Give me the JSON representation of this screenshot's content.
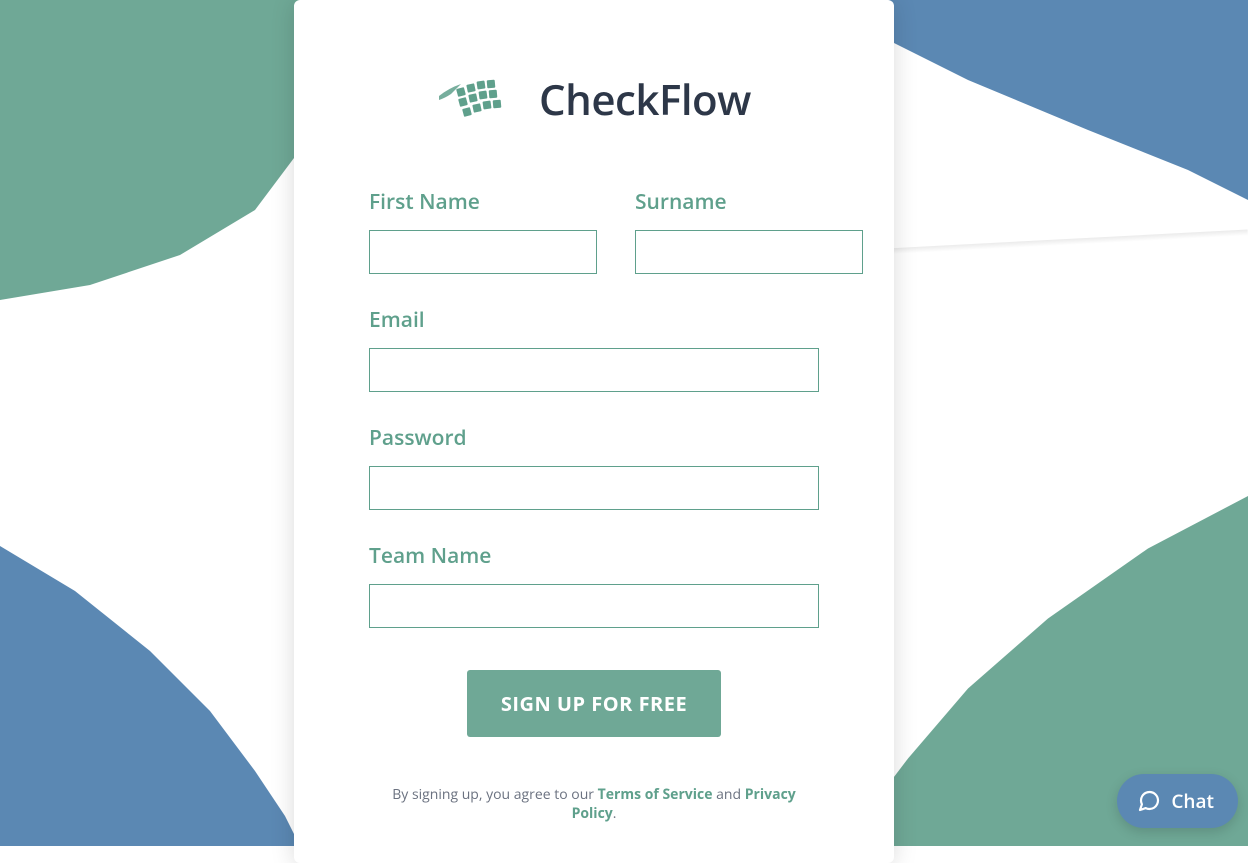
{
  "brand": {
    "name": "CheckFlow"
  },
  "form": {
    "first_name": {
      "label": "First Name",
      "value": ""
    },
    "surname": {
      "label": "Surname",
      "value": ""
    },
    "email": {
      "label": "Email",
      "value": ""
    },
    "password": {
      "label": "Password",
      "value": ""
    },
    "team_name": {
      "label": "Team Name",
      "value": ""
    },
    "submit_label": "SIGN UP FOR FREE"
  },
  "legal": {
    "prefix": "By signing up, you agree to our ",
    "terms_label": "Terms of Service",
    "conjunction": " and ",
    "privacy_label": "Privacy Policy",
    "suffix": "."
  },
  "chat": {
    "label": "Chat"
  },
  "colors": {
    "accent_green": "#6fa896",
    "accent_blue": "#5b88b3",
    "label_green": "#5fa08c",
    "text_dark": "#2d3748"
  }
}
